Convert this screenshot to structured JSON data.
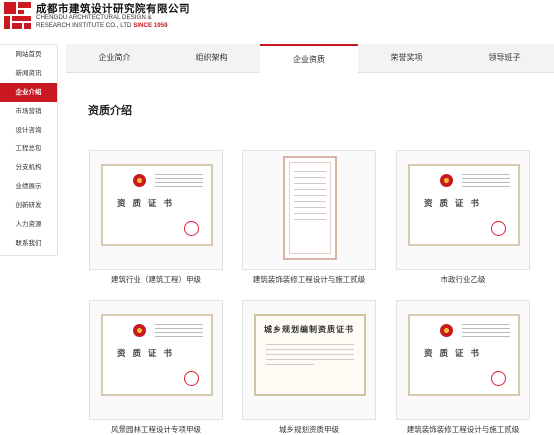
{
  "header": {
    "company_cn": "成都市建筑设计研究院有限公司",
    "company_en_1": "CHENGDU ARCHITECTURAL DESIGN &",
    "company_en_2": "RESEARCH INSTITUTE CO., LTD",
    "since": "SINCE 1959",
    "brand_color": "#c9181f"
  },
  "sidebar": {
    "items": [
      {
        "label": "网站首页",
        "active": false
      },
      {
        "label": "新闻资讯",
        "active": false
      },
      {
        "label": "企业介绍",
        "active": true
      },
      {
        "label": "市场营销",
        "active": false
      },
      {
        "label": "设计咨询",
        "active": false
      },
      {
        "label": "工程总包",
        "active": false
      },
      {
        "label": "分支机构",
        "active": false
      },
      {
        "label": "业绩展示",
        "active": false
      },
      {
        "label": "创新研发",
        "active": false
      },
      {
        "label": "人力资源",
        "active": false
      },
      {
        "label": "联系我们",
        "active": false
      }
    ]
  },
  "tabs": [
    {
      "label": "企业简介",
      "active": false
    },
    {
      "label": "组织架构",
      "active": false
    },
    {
      "label": "企业资质",
      "active": true
    },
    {
      "label": "荣誉奖项",
      "active": false
    },
    {
      "label": "领导班子",
      "active": false
    }
  ],
  "section_title": "资质介绍",
  "certificates": [
    {
      "caption": "建筑行业（建筑工程）甲级",
      "style": "landscape",
      "cert_title": "资 质 证 书"
    },
    {
      "caption": "建筑装饰装修工程设计与施工贰级",
      "style": "portrait",
      "cert_title": ""
    },
    {
      "caption": "市政行业乙级",
      "style": "landscape",
      "cert_title": "资 质 证 书"
    },
    {
      "caption": "风景园林工程设计专项甲级",
      "style": "landscape",
      "cert_title": "资 质 证 书"
    },
    {
      "caption": "城乡规划资质甲级",
      "style": "plain",
      "cert_title": "城乡规划编制资质证书"
    },
    {
      "caption": "建筑装饰装修工程设计与施工贰级",
      "style": "landscape",
      "cert_title": "资 质 证 书"
    }
  ]
}
